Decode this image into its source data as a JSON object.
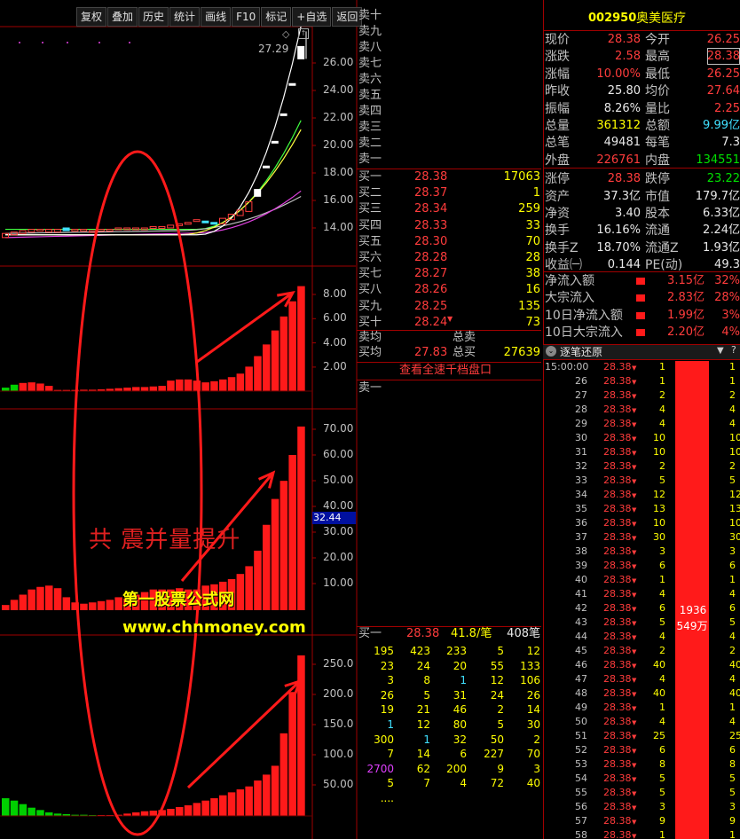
{
  "toolbar": {
    "items": [
      "复权",
      "叠加",
      "历史",
      "统计",
      "画线",
      "F10",
      "标记",
      "+自选",
      "返回"
    ]
  },
  "price_panel": {
    "top_price": "27.29",
    "ticks": [
      "26.00",
      "24.00",
      "22.00",
      "20.00",
      "18.00",
      "16.00",
      "14.00"
    ]
  },
  "panel2": {
    "ticks": [
      "8.00",
      "6.00",
      "4.00",
      "2.00"
    ]
  },
  "panel3": {
    "ticks": [
      "70.00",
      "60.00",
      "50.00",
      "40.00",
      "30.00",
      "20.00",
      "10.00"
    ],
    "marker": "32.44"
  },
  "panel4": {
    "ticks": [
      "250.0",
      "200.0",
      "150.0",
      "100.0",
      "50.00"
    ]
  },
  "annotation": {
    "text": "共 震并量提升"
  },
  "watermark": {
    "line1": "第一股票公式网",
    "line2": "www.chnmoney.com"
  },
  "chart_data": [
    {
      "type": "bar",
      "title": "panel2",
      "ylim": [
        0,
        9.2
      ],
      "values": [
        0.3,
        0.55,
        0.7,
        0.75,
        0.65,
        0.45,
        0.1,
        0.1,
        0.1,
        0.12,
        0.12,
        0.15,
        0.2,
        0.25,
        0.3,
        0.35,
        0.35,
        0.4,
        0.45,
        0.9,
        1.0,
        1.0,
        0.9,
        0.75,
        0.85,
        1.0,
        1.2,
        1.5,
        2.1,
        3.0,
        4.0,
        5.2,
        6.4,
        7.7,
        9.0
      ],
      "negative_first": 2
    },
    {
      "type": "bar",
      "title": "panel3",
      "ylim": [
        0,
        72
      ],
      "values": [
        2,
        4,
        6,
        8,
        9,
        9.5,
        8.5,
        5,
        3,
        2.5,
        3,
        3.5,
        4,
        5,
        4.5,
        6,
        7,
        8,
        8,
        8,
        8.5,
        8,
        8,
        9.5,
        10,
        11,
        12,
        14,
        17,
        23,
        33,
        43,
        50,
        60,
        71
      ]
    },
    {
      "type": "bar",
      "title": "panel4",
      "ylim": [
        0,
        275
      ],
      "values": [
        -30,
        -26,
        -20,
        -14,
        -10,
        -6,
        -4,
        -3,
        -2,
        -2,
        -1,
        1,
        1,
        2,
        4,
        6,
        8,
        9,
        10,
        12,
        15,
        18,
        22,
        26,
        30,
        35,
        40,
        45,
        50,
        60,
        70,
        85,
        140,
        210,
        272
      ]
    }
  ],
  "orderbook": {
    "sell_labels": [
      "卖十",
      "卖九",
      "卖八",
      "卖七",
      "卖六",
      "卖五",
      "卖四",
      "卖三",
      "卖二",
      "卖一"
    ],
    "buy": [
      {
        "label": "买一",
        "price": "28.38",
        "vol": "17063"
      },
      {
        "label": "买二",
        "price": "28.37",
        "vol": "1"
      },
      {
        "label": "买三",
        "price": "28.34",
        "vol": "259"
      },
      {
        "label": "买四",
        "price": "28.33",
        "vol": "33"
      },
      {
        "label": "买五",
        "price": "28.30",
        "vol": "70"
      },
      {
        "label": "买六",
        "price": "28.28",
        "vol": "28"
      },
      {
        "label": "买七",
        "price": "28.27",
        "vol": "38"
      },
      {
        "label": "买八",
        "price": "28.26",
        "vol": "16"
      },
      {
        "label": "买九",
        "price": "28.25",
        "vol": "135"
      },
      {
        "label": "买十",
        "price": "28.24",
        "vol": "73"
      }
    ],
    "sell_avg_label": "卖均",
    "total_sell_label": "总卖",
    "buy_avg_label": "买均",
    "buy_avg": "27.83",
    "total_buy_label": "总买",
    "total_buy": "27639",
    "view_all": "查看全速千档盘口",
    "sell1_label": "卖一",
    "buy1_summary": {
      "label": "买一",
      "price": "28.38",
      "per": "41.8/笔",
      "count": "408笔"
    },
    "queue": [
      [
        "195",
        "423",
        "233",
        "5",
        "12"
      ],
      [
        "23",
        "24",
        "20",
        "55",
        "133"
      ],
      [
        "3",
        "8",
        "1",
        "12",
        "106"
      ],
      [
        "26",
        "5",
        "31",
        "24",
        "26"
      ],
      [
        "19",
        "21",
        "46",
        "2",
        "14"
      ],
      [
        "1",
        "12",
        "80",
        "5",
        "30"
      ],
      [
        "300",
        "1",
        "32",
        "50",
        "2"
      ],
      [
        "7",
        "14",
        "6",
        "227",
        "70"
      ],
      [
        "2700",
        "62",
        "200",
        "9",
        "3"
      ],
      [
        "5",
        "7",
        "4",
        "72",
        "40"
      ],
      [
        "....",
        "",
        "",
        "",
        ""
      ]
    ]
  },
  "quote": {
    "code": "002950",
    "name": "奥美医疗",
    "rows": [
      [
        {
          "l": "现价",
          "v": "28.38",
          "c": "red"
        },
        {
          "l": "今开",
          "v": "26.25",
          "c": "red"
        }
      ],
      [
        {
          "l": "涨跌",
          "v": "2.58",
          "c": "red"
        },
        {
          "l": "最高",
          "v": "28.38",
          "c": "red"
        }
      ],
      [
        {
          "l": "涨幅",
          "v": "10.00%",
          "c": "red"
        },
        {
          "l": "最低",
          "v": "26.25",
          "c": "red"
        }
      ],
      [
        {
          "l": "昨收",
          "v": "25.80",
          "c": "wht"
        },
        {
          "l": "均价",
          "v": "27.64",
          "c": "red"
        }
      ],
      [
        {
          "l": "振幅",
          "v": "8.26%",
          "c": "wht"
        },
        {
          "l": "量比",
          "v": "2.25",
          "c": "red"
        }
      ],
      [
        {
          "l": "总量",
          "v": "361312",
          "c": "yel"
        },
        {
          "l": "总额",
          "v": "9.99亿",
          "c": "cyan"
        }
      ],
      [
        {
          "l": "总笔",
          "v": "49481",
          "c": "wht"
        },
        {
          "l": "每笔",
          "v": "7.3",
          "c": "wht"
        }
      ],
      [
        {
          "l": "外盘",
          "v": "226761",
          "c": "red"
        },
        {
          "l": "内盘",
          "v": "134551",
          "c": "grn"
        }
      ],
      [
        {
          "l": "涨停",
          "v": "28.38",
          "c": "red"
        },
        {
          "l": "跌停",
          "v": "23.22",
          "c": "grn"
        }
      ],
      [
        {
          "l": "资产",
          "v": "37.3亿",
          "c": "wht"
        },
        {
          "l": "市值",
          "v": "179.7亿",
          "c": "wht"
        }
      ],
      [
        {
          "l": "净资",
          "v": "3.40",
          "c": "wht"
        },
        {
          "l": "股本",
          "v": "6.33亿",
          "c": "wht"
        }
      ],
      [
        {
          "l": "换手",
          "v": "16.16%",
          "c": "wht"
        },
        {
          "l": "流通",
          "v": "2.24亿",
          "c": "wht"
        }
      ],
      [
        {
          "l": "换手Z",
          "v": "18.70%",
          "c": "wht"
        },
        {
          "l": "流通Z",
          "v": "1.93亿",
          "c": "wht"
        }
      ],
      [
        {
          "l": "收益㈠",
          "v": "0.144",
          "c": "wht"
        },
        {
          "l": "PE(动)",
          "v": "49.3",
          "c": "wht"
        }
      ]
    ],
    "flows": [
      {
        "l": "净流入额",
        "v": "3.15亿",
        "p": "32%"
      },
      {
        "l": "大宗流入",
        "v": "2.83亿",
        "p": "28%"
      },
      {
        "l": "10日净流入额",
        "v": "1.99亿",
        "p": "3%"
      },
      {
        "l": "10日大宗流入",
        "v": "2.20亿",
        "p": "4%"
      }
    ]
  },
  "ticks": {
    "title": "逐笔还原",
    "bar_text1": "1936",
    "bar_text2": "549万",
    "rows": [
      {
        "t": "15:00:00",
        "p": "28.38",
        "v": "1",
        "r": "1"
      },
      {
        "t": "26",
        "p": "28.38",
        "v": "1",
        "r": "1"
      },
      {
        "t": "27",
        "p": "28.38",
        "v": "2",
        "r": "2"
      },
      {
        "t": "28",
        "p": "28.38",
        "v": "4",
        "r": "4"
      },
      {
        "t": "29",
        "p": "28.38",
        "v": "4",
        "r": "4"
      },
      {
        "t": "30",
        "p": "28.38",
        "v": "10",
        "r": "10"
      },
      {
        "t": "31",
        "p": "28.38",
        "v": "10",
        "r": "10"
      },
      {
        "t": "32",
        "p": "28.38",
        "v": "2",
        "r": "2"
      },
      {
        "t": "33",
        "p": "28.38",
        "v": "5",
        "r": "5"
      },
      {
        "t": "34",
        "p": "28.38",
        "v": "12",
        "r": "12"
      },
      {
        "t": "35",
        "p": "28.38",
        "v": "13",
        "r": "13"
      },
      {
        "t": "36",
        "p": "28.38",
        "v": "10",
        "r": "10"
      },
      {
        "t": "37",
        "p": "28.38",
        "v": "30",
        "r": "30"
      },
      {
        "t": "38",
        "p": "28.38",
        "v": "3",
        "r": "3"
      },
      {
        "t": "39",
        "p": "28.38",
        "v": "6",
        "r": "6"
      },
      {
        "t": "40",
        "p": "28.38",
        "v": "1",
        "r": "1"
      },
      {
        "t": "41",
        "p": "28.38",
        "v": "4",
        "r": "4"
      },
      {
        "t": "42",
        "p": "28.38",
        "v": "6",
        "r": "6"
      },
      {
        "t": "43",
        "p": "28.38",
        "v": "5",
        "r": "5"
      },
      {
        "t": "44",
        "p": "28.38",
        "v": "4",
        "r": "4"
      },
      {
        "t": "45",
        "p": "28.38",
        "v": "2",
        "r": "2"
      },
      {
        "t": "46",
        "p": "28.38",
        "v": "40",
        "r": "40"
      },
      {
        "t": "47",
        "p": "28.38",
        "v": "4",
        "r": "4"
      },
      {
        "t": "48",
        "p": "28.38",
        "v": "40",
        "r": "40"
      },
      {
        "t": "49",
        "p": "28.38",
        "v": "1",
        "r": "1"
      },
      {
        "t": "50",
        "p": "28.38",
        "v": "4",
        "r": "4"
      },
      {
        "t": "51",
        "p": "28.38",
        "v": "25",
        "r": "25"
      },
      {
        "t": "52",
        "p": "28.38",
        "v": "6",
        "r": "6"
      },
      {
        "t": "53",
        "p": "28.38",
        "v": "8",
        "r": "8"
      },
      {
        "t": "54",
        "p": "28.38",
        "v": "5",
        "r": "5"
      },
      {
        "t": "55",
        "p": "28.38",
        "v": "5",
        "r": "5"
      },
      {
        "t": "56",
        "p": "28.38",
        "v": "3",
        "r": "3"
      },
      {
        "t": "57",
        "p": "28.38",
        "v": "9",
        "r": "9"
      },
      {
        "t": "58",
        "p": "28.38",
        "v": "1",
        "r": "1"
      }
    ]
  }
}
